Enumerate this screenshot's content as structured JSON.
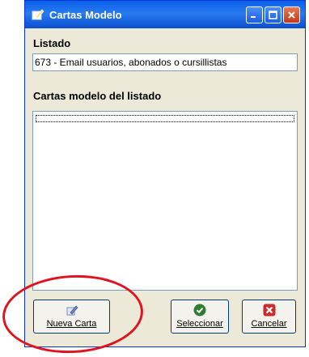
{
  "window": {
    "title": "Cartas Modelo"
  },
  "listado": {
    "label": "Listado",
    "value": "673 - Email usuarios, abonados o cursillistas"
  },
  "cartas": {
    "label": "Cartas modelo del listado",
    "items": []
  },
  "buttons": {
    "nueva_carta": "Nueva Carta",
    "seleccionar": "Seleccionar",
    "cancelar": "Cancelar"
  },
  "colors": {
    "titlebar": "#0a5fe8",
    "window_bg": "#ece9d8",
    "highlight": "#e0141e"
  }
}
